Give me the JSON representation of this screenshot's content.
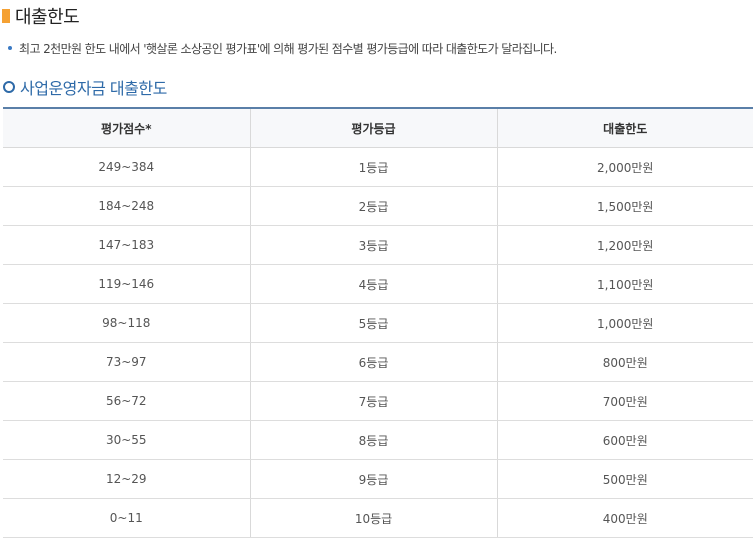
{
  "header": {
    "title": "대출한도"
  },
  "note": {
    "text": "최고 2천만원 한도 내에서 '햇살론 소상공인 평가표'에 의해 평가된 점수별 평가등급에 따라 대출한도가 달라집니다."
  },
  "section": {
    "title": "사업운영자금 대출한도"
  },
  "table": {
    "columns": [
      "평가점수*",
      "평가등급",
      "대출한도"
    ],
    "rows": [
      [
        "249~384",
        "1등급",
        "2,000만원"
      ],
      [
        "184~248",
        "2등급",
        "1,500만원"
      ],
      [
        "147~183",
        "3등급",
        "1,200만원"
      ],
      [
        "119~146",
        "4등급",
        "1,100만원"
      ],
      [
        "98~118",
        "5등급",
        "1,000만원"
      ],
      [
        "73~97",
        "6등급",
        "800만원"
      ],
      [
        "56~72",
        "7등급",
        "700만원"
      ],
      [
        "30~55",
        "8등급",
        "600만원"
      ],
      [
        "12~29",
        "9등급",
        "500만원"
      ],
      [
        "0~11",
        "10등급",
        "400만원"
      ]
    ]
  }
}
